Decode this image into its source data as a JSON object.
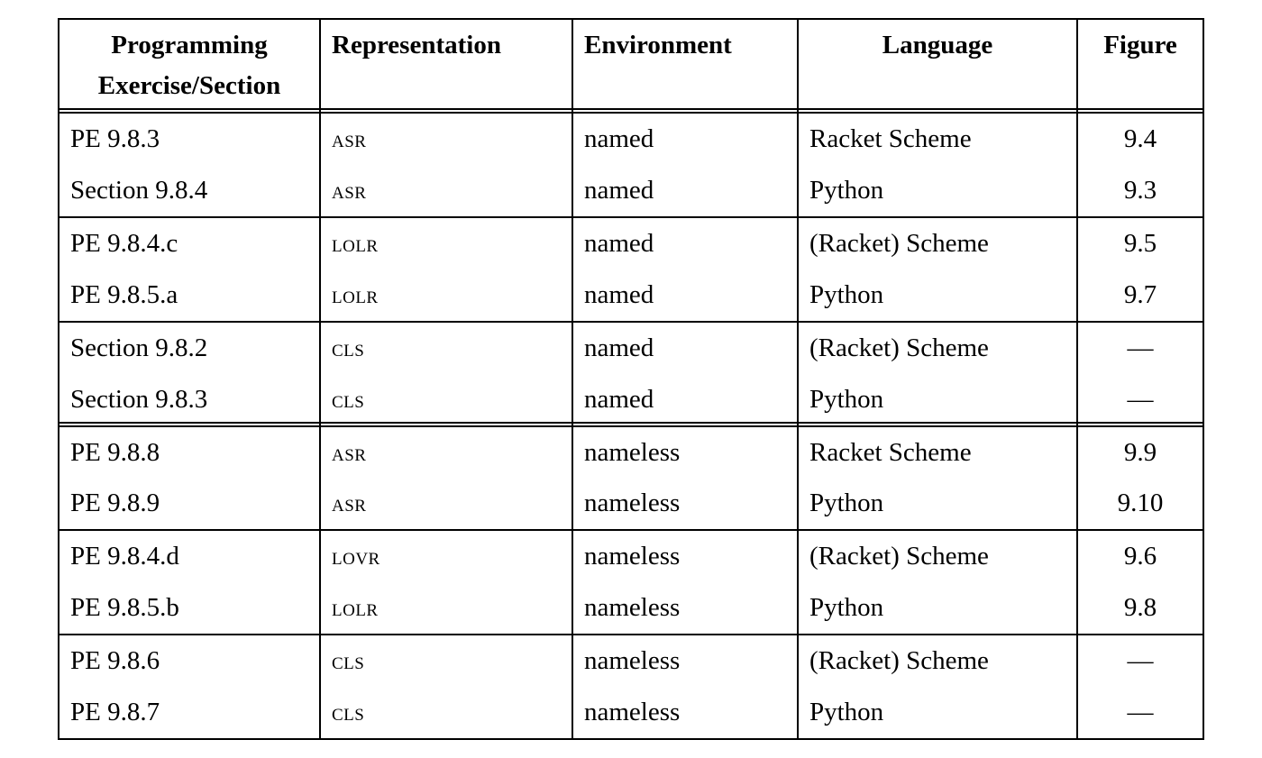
{
  "chart_data": {
    "type": "table",
    "columns": [
      "Programming Exercise/Section",
      "Representation",
      "Environment",
      "Language",
      "Figure"
    ],
    "groups": [
      {
        "double_rule_above": true,
        "rows": [
          {
            "exercise": "PE 9.8.3",
            "representation": "ASR",
            "environment": "named",
            "language": "Racket Scheme",
            "figure": "9.4"
          },
          {
            "exercise": "Section 9.8.4",
            "representation": "ASR",
            "environment": "named",
            "language": "Python",
            "figure": "9.3"
          }
        ]
      },
      {
        "double_rule_above": false,
        "rows": [
          {
            "exercise": "PE 9.8.4.c",
            "representation": "LOLR",
            "environment": "named",
            "language": "(Racket) Scheme",
            "figure": "9.5"
          },
          {
            "exercise": "PE 9.8.5.a",
            "representation": "LOLR",
            "environment": "named",
            "language": "Python",
            "figure": "9.7"
          }
        ]
      },
      {
        "double_rule_above": false,
        "rows": [
          {
            "exercise": "Section 9.8.2",
            "representation": "CLS",
            "environment": "named",
            "language": "(Racket) Scheme",
            "figure": "—"
          },
          {
            "exercise": "Section 9.8.3",
            "representation": "CLS",
            "environment": "named",
            "language": "Python",
            "figure": "—"
          }
        ]
      },
      {
        "double_rule_above": true,
        "rows": [
          {
            "exercise": "PE 9.8.8",
            "representation": "ASR",
            "environment": "nameless",
            "language": "Racket Scheme",
            "figure": "9.9"
          },
          {
            "exercise": "PE 9.8.9",
            "representation": "ASR",
            "environment": "nameless",
            "language": "Python",
            "figure": "9.10"
          }
        ]
      },
      {
        "double_rule_above": false,
        "rows": [
          {
            "exercise": "PE 9.8.4.d",
            "representation": "LOVR",
            "environment": "nameless",
            "language": "(Racket) Scheme",
            "figure": "9.6"
          },
          {
            "exercise": "PE 9.8.5.b",
            "representation": "LOLR",
            "environment": "nameless",
            "language": "Python",
            "figure": "9.8"
          }
        ]
      },
      {
        "double_rule_above": false,
        "rows": [
          {
            "exercise": "PE 9.8.6",
            "representation": "CLS",
            "environment": "nameless",
            "language": "(Racket) Scheme",
            "figure": "—"
          },
          {
            "exercise": "PE 9.8.7",
            "representation": "CLS",
            "environment": "nameless",
            "language": "Python",
            "figure": "—"
          }
        ]
      }
    ]
  },
  "header": {
    "col1_line1": "Programming",
    "col1_line2": "Exercise/Section",
    "col2": "Representation",
    "col3": "Environment",
    "col4": "Language",
    "col5": "Figure"
  }
}
